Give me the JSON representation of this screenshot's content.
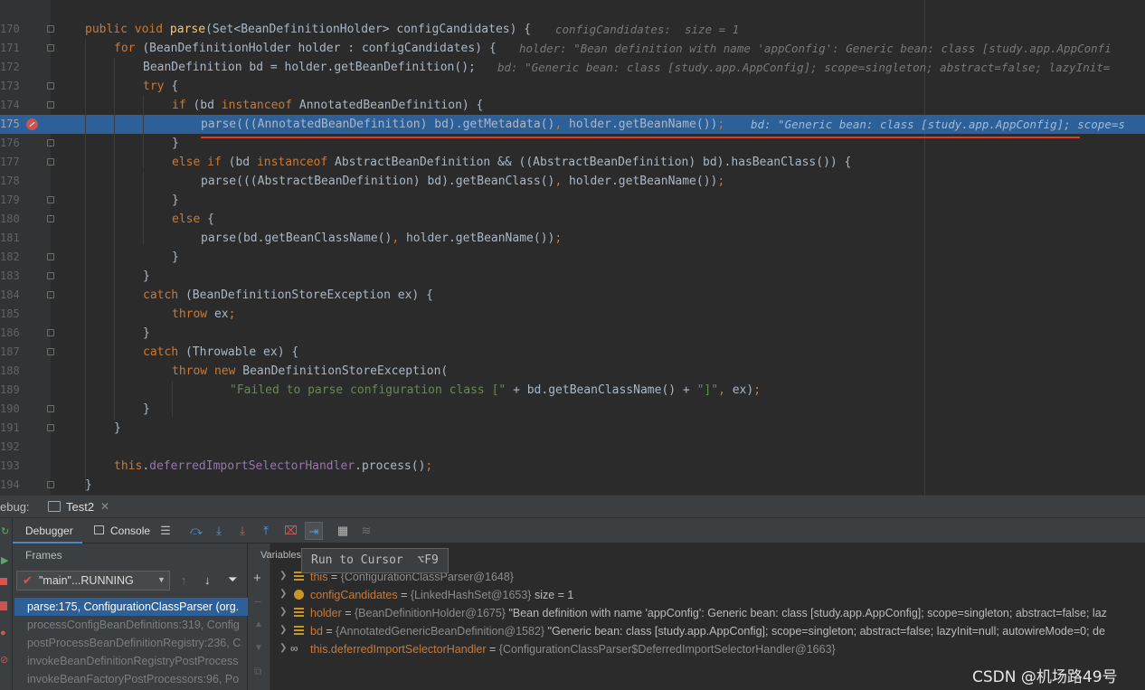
{
  "editor": {
    "lines": [
      {
        "num": "170",
        "parts": [
          [
            "kw",
            "public void "
          ],
          [
            "fn",
            "parse"
          ],
          [
            "",
            "(Set<BeanDefinitionHolder> configCandidates) {"
          ]
        ],
        "hint": "configCandidates:  size = 1"
      },
      {
        "num": "171",
        "parts": [
          [
            "kw",
            "for "
          ],
          [
            "",
            "(BeanDefinitionHolder holder : configCandidates) {"
          ]
        ],
        "hint": "holder: \"Bean definition with name 'appConfig': Generic bean: class [study.app.AppConfi"
      },
      {
        "num": "172",
        "parts": [
          [
            "",
            "BeanDefinition bd = holder.getBeanDefinition();"
          ]
        ],
        "hint": "bd: \"Generic bean: class [study.app.AppConfig]; scope=singleton; abstract=false; lazyInit="
      },
      {
        "num": "173",
        "parts": [
          [
            "kw",
            "try "
          ],
          [
            "",
            "{"
          ]
        ],
        "hint": ""
      },
      {
        "num": "174",
        "parts": [
          [
            "kw",
            "if "
          ],
          [
            "",
            "(bd "
          ],
          [
            "kw",
            "instanceof "
          ],
          [
            "",
            "AnnotatedBeanDefinition) {"
          ]
        ],
        "hint": ""
      },
      {
        "num": "175",
        "parts": [
          [
            "",
            "parse(((AnnotatedBeanDefinition) bd).getMetadata()"
          ],
          [
            "kw",
            ", "
          ],
          [
            "",
            "holder.getBeanName())"
          ],
          [
            "kw",
            ";"
          ]
        ],
        "hint": "bd: \"Generic bean: class [study.app.AppConfig]; scope=s"
      },
      {
        "num": "176",
        "parts": [
          [
            "",
            "}"
          ]
        ],
        "hint": ""
      },
      {
        "num": "177",
        "parts": [
          [
            "kw",
            "else if "
          ],
          [
            "",
            "(bd "
          ],
          [
            "kw",
            "instanceof "
          ],
          [
            "",
            "AbstractBeanDefinition && ((AbstractBeanDefinition) bd).hasBeanClass()) {"
          ]
        ],
        "hint": ""
      },
      {
        "num": "178",
        "parts": [
          [
            "",
            "parse(((AbstractBeanDefinition) bd).getBeanClass()"
          ],
          [
            "kw",
            ", "
          ],
          [
            "",
            "holder.getBeanName())"
          ],
          [
            "kw",
            ";"
          ]
        ],
        "hint": ""
      },
      {
        "num": "179",
        "parts": [
          [
            "",
            "}"
          ]
        ],
        "hint": ""
      },
      {
        "num": "180",
        "parts": [
          [
            "kw",
            "else "
          ],
          [
            "",
            "{"
          ]
        ],
        "hint": ""
      },
      {
        "num": "181",
        "parts": [
          [
            "",
            "parse(bd.getBeanClassName()"
          ],
          [
            "kw",
            ", "
          ],
          [
            "",
            "holder.getBeanName())"
          ],
          [
            "kw",
            ";"
          ]
        ],
        "hint": ""
      },
      {
        "num": "182",
        "parts": [
          [
            "",
            "}"
          ]
        ],
        "hint": ""
      },
      {
        "num": "183",
        "parts": [
          [
            "",
            "}"
          ]
        ],
        "hint": ""
      },
      {
        "num": "184",
        "parts": [
          [
            "kw",
            "catch "
          ],
          [
            "",
            "(BeanDefinitionStoreException ex) {"
          ]
        ],
        "hint": ""
      },
      {
        "num": "185",
        "parts": [
          [
            "kw",
            "throw "
          ],
          [
            "",
            "ex"
          ],
          [
            "kw",
            ";"
          ]
        ],
        "hint": ""
      },
      {
        "num": "186",
        "parts": [
          [
            "",
            "}"
          ]
        ],
        "hint": ""
      },
      {
        "num": "187",
        "parts": [
          [
            "kw",
            "catch "
          ],
          [
            "",
            "(Throwable ex) {"
          ]
        ],
        "hint": ""
      },
      {
        "num": "188",
        "parts": [
          [
            "kw",
            "throw new "
          ],
          [
            "",
            "BeanDefinitionStoreException("
          ]
        ],
        "hint": ""
      },
      {
        "num": "189",
        "parts": [
          [
            "str",
            "\"Failed to parse configuration class [\" "
          ],
          [
            "",
            "+ bd.getBeanClassName() + "
          ],
          [
            "str",
            "\"]\""
          ],
          [
            "kw",
            ", "
          ],
          [
            "",
            "ex)"
          ],
          [
            "kw",
            ";"
          ]
        ],
        "hint": ""
      },
      {
        "num": "190",
        "parts": [
          [
            "",
            "}"
          ]
        ],
        "hint": ""
      },
      {
        "num": "191",
        "parts": [
          [
            "",
            "}"
          ]
        ],
        "hint": ""
      },
      {
        "num": "192",
        "parts": [],
        "hint": ""
      },
      {
        "num": "193",
        "parts": [
          [
            "kw",
            "this"
          ],
          [
            "",
            "."
          ],
          [
            "fld",
            "deferredImportSelectorHandler"
          ],
          [
            "",
            ".process()"
          ],
          [
            "kw",
            ";"
          ]
        ],
        "hint": ""
      },
      {
        "num": "194",
        "parts": [
          [
            "",
            "}"
          ]
        ],
        "hint": ""
      }
    ]
  },
  "debug": {
    "label": "ebug:",
    "session_tab": "Test2",
    "tabs": {
      "debugger": "Debugger",
      "console": "Console"
    },
    "frames_title": "Frames",
    "thread": "\"main\"...RUNNING",
    "frames": [
      "parse:175, ConfigurationClassParser (org.",
      "processConfigBeanDefinitions:319, Config",
      "postProcessBeanDefinitionRegistry:236, C",
      "invokeBeanDefinitionRegistryPostProcess",
      "invokeBeanFactoryPostProcessors:96, Po"
    ],
    "variables_title": "Variables",
    "tooltip": "Run to Cursor  ⌥F9",
    "variables": [
      {
        "name": "this",
        "ref": "{ConfigurationClassParser@1648}",
        "value": ""
      },
      {
        "name": "configCandidates",
        "ref": "{LinkedHashSet@1653}",
        "value": " size = 1"
      },
      {
        "name": "holder",
        "ref": "{BeanDefinitionHolder@1675}",
        "value": " \"Bean definition with name 'appConfig': Generic bean: class [study.app.AppConfig]; scope=singleton; abstract=false; laz"
      },
      {
        "name": "bd",
        "ref": "{AnnotatedGenericBeanDefinition@1582}",
        "value": " \"Generic bean: class [study.app.AppConfig]; scope=singleton; abstract=false; lazyInit=null; autowireMode=0; de"
      },
      {
        "name": "this.deferredImportSelectorHandler",
        "ref": "{ConfigurationClassParser$DeferredImportSelectorHandler@1663}",
        "value": ""
      }
    ]
  },
  "watermark": "CSDN @机场路49号",
  "colors": {
    "accent": "#2d6099",
    "breakpoint": "#c75450",
    "underline": "#e03b2c"
  }
}
